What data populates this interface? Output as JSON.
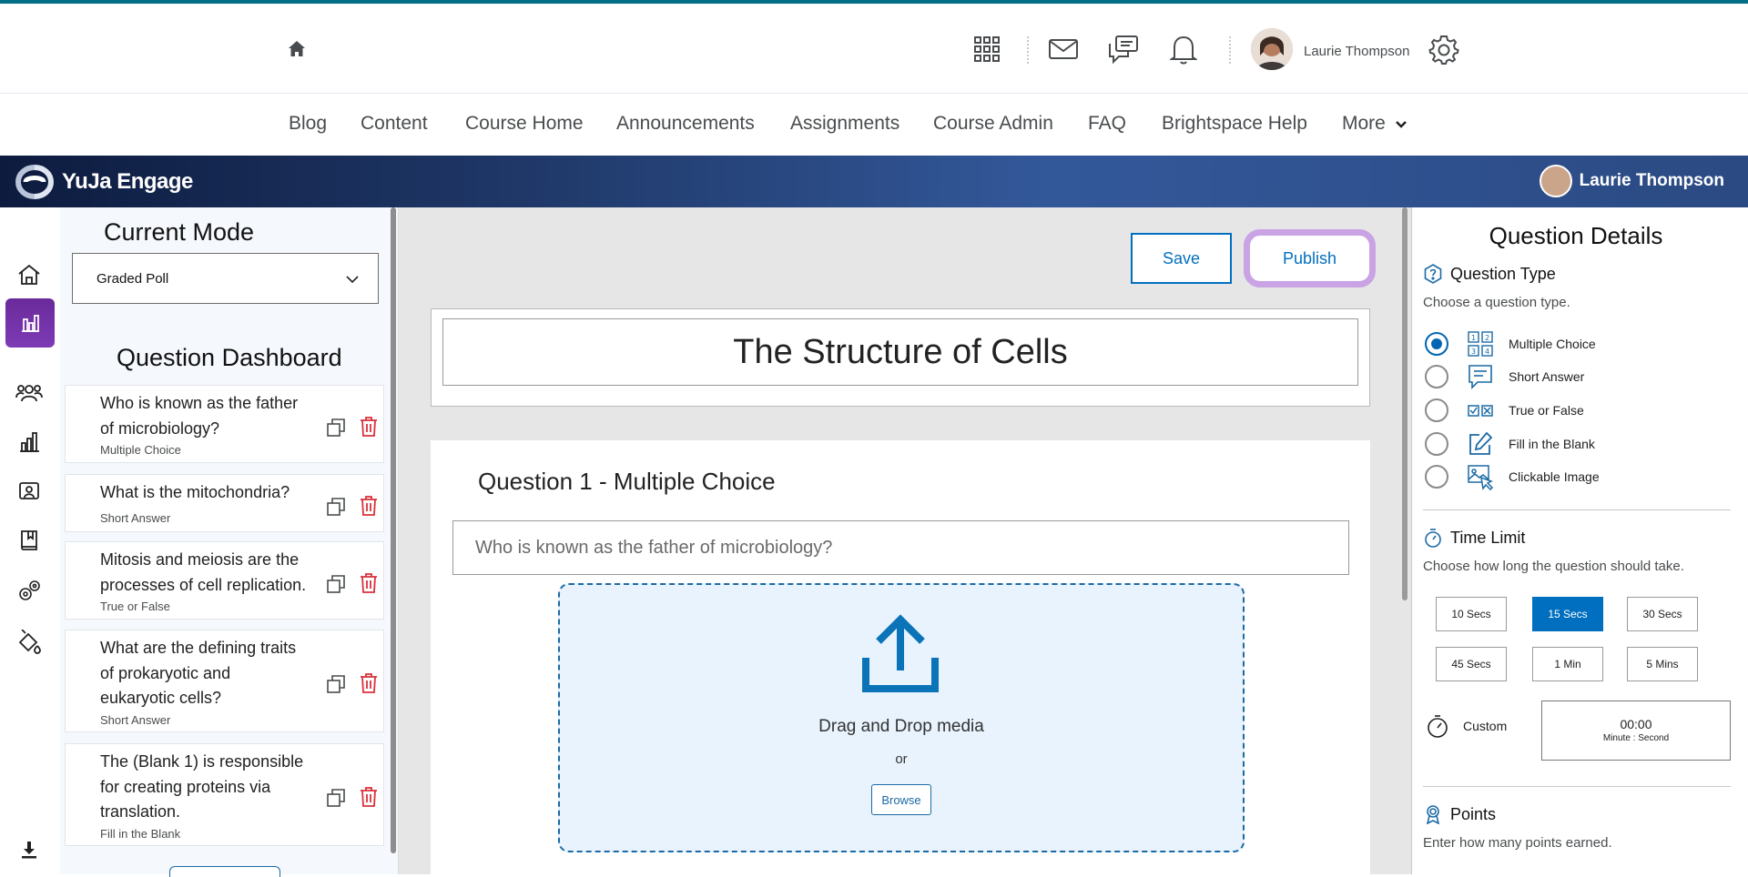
{
  "top_bar": {
    "user_name": "Laurie Thompson"
  },
  "nav": {
    "items": [
      "Blog",
      "Content",
      "Course Home",
      "Announcements",
      "Assignments",
      "Course Admin",
      "FAQ",
      "Brightspace Help",
      "More"
    ]
  },
  "yuja": {
    "logo_text": "YuJa Engage",
    "user_name": "Laurie Thompson"
  },
  "left_panel": {
    "mode_title": "Current Mode",
    "mode_value": "Graded Poll",
    "dashboard_title": "Question Dashboard",
    "questions": [
      {
        "text": "Who is known as the father of microbiology?",
        "type": "Multiple Choice"
      },
      {
        "text": "What is the mitochondria?",
        "type": "Short Answer"
      },
      {
        "text": "Mitosis and meiosis are the processes of cell replication.",
        "type": "True or False"
      },
      {
        "text": "What are the defining traits of prokaryotic and eukaryotic cells?",
        "type": "Short Answer"
      },
      {
        "text": "The (Blank 1) is responsible for creating proteins via translation.",
        "type": "Fill in the Blank"
      }
    ]
  },
  "editor": {
    "save_label": "Save",
    "publish_label": "Publish",
    "poll_title": "The Structure of Cells",
    "question_heading": "Question 1 - Multiple Choice",
    "question_text": "Who is known as the father of microbiology?",
    "drop_text": "Drag and Drop media",
    "or_text": "or",
    "browse_label": "Browse"
  },
  "details": {
    "title": "Question Details",
    "type_heading": "Question Type",
    "type_sub": "Choose a question type.",
    "types": [
      {
        "label": "Multiple Choice",
        "selected": true,
        "icon": "multiple-choice-icon"
      },
      {
        "label": "Short Answer",
        "selected": false,
        "icon": "short-answer-icon"
      },
      {
        "label": "True or False",
        "selected": false,
        "icon": "true-false-icon"
      },
      {
        "label": "Fill in the Blank",
        "selected": false,
        "icon": "fill-blank-icon"
      },
      {
        "label": "Clickable Image",
        "selected": false,
        "icon": "clickable-image-icon"
      }
    ],
    "time_heading": "Time Limit",
    "time_sub": "Choose how long the question should take.",
    "time_options": [
      "10 Secs",
      "15 Secs",
      "30 Secs",
      "45 Secs",
      "1 Min",
      "5 Mins"
    ],
    "time_selected": "15 Secs",
    "custom_label": "Custom",
    "custom_time": "00:00",
    "custom_hint": "Minute : Second",
    "points_heading": "Points",
    "points_sub": "Enter how many points earned."
  },
  "colors": {
    "accent": "#006fbf",
    "publish_ring": "#c9a3e3",
    "delete": "#d9303a",
    "active_rail": "#7d3bb5"
  }
}
